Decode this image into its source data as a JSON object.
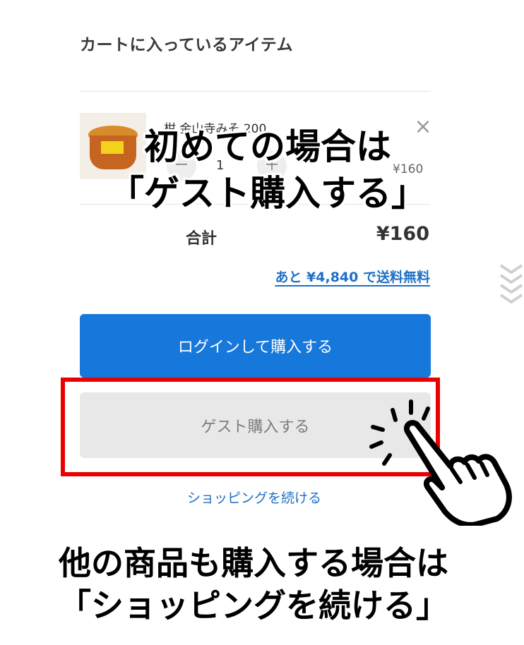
{
  "cart": {
    "title": "カートに入っているアイテム",
    "item": {
      "name": "柑 金山寺みそ 200",
      "quantity": "1",
      "minus": "－",
      "plus": "＋",
      "price": "¥160",
      "remove_symbol": "×"
    },
    "total_label": "合計",
    "total_value": "¥160",
    "free_shipping_notice": "あと ¥4,840 で送料無料"
  },
  "buttons": {
    "login_purchase": "ログインして購入する",
    "guest_purchase": "ゲスト購入する",
    "continue_shopping": "ショッピングを続ける"
  },
  "overlay_text": {
    "top_line1": "初めての場合は",
    "top_line2": "「ゲスト購入する」",
    "bottom_line1": "他の商品も購入する場合は",
    "bottom_line2": "「ショッピングを続ける」"
  },
  "colors": {
    "primary_blue": "#1778dc",
    "link_blue": "#1f6fc6",
    "highlight_red": "#ea0000",
    "guest_button_gray": "#e8e8e8"
  },
  "icons": {
    "remove": "close-icon",
    "scroll": "chevrons-down-icon",
    "pointer": "pointing-hand-icon"
  }
}
